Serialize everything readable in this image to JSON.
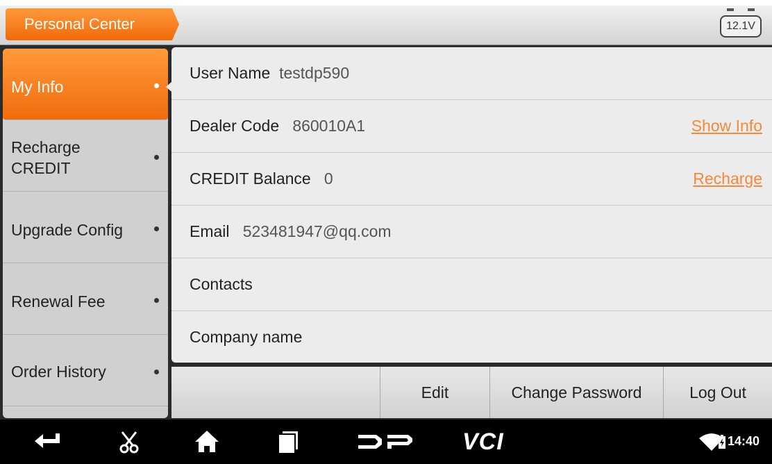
{
  "header": {
    "title": "Personal Center",
    "battery_voltage": "12.1V"
  },
  "sidebar": {
    "items": [
      {
        "label": "My Info",
        "active": true
      },
      {
        "label": "Recharge\nCREDIT",
        "active": false
      },
      {
        "label": "Upgrade Config",
        "active": false
      },
      {
        "label": "Renewal Fee",
        "active": false
      },
      {
        "label": "Order History",
        "active": false
      }
    ]
  },
  "info": {
    "user_name": {
      "label": "User Name",
      "value": "testdp590"
    },
    "dealer_code": {
      "label": "Dealer Code",
      "value": "860010A1",
      "link": "Show Info"
    },
    "credit_balance": {
      "label": "CREDIT Balance",
      "value": "0",
      "link": "Recharge"
    },
    "email": {
      "label": "Email",
      "value": "523481947@qq.com"
    },
    "contacts": {
      "label": "Contacts",
      "value": ""
    },
    "company_name": {
      "label": "Company name",
      "value": ""
    }
  },
  "actions": {
    "edit": "Edit",
    "change_password": "Change Password",
    "log_out": "Log Out"
  },
  "navbar": {
    "icons": [
      "back-icon",
      "scissors-icon",
      "home-icon",
      "recents-icon",
      "dp-logo",
      "vci-logo",
      "wifi-icon",
      "battery-icon"
    ],
    "vci_label": "VCI",
    "time": "14:40"
  },
  "colors": {
    "accent": "#f5883a",
    "link": "#f5883a"
  }
}
